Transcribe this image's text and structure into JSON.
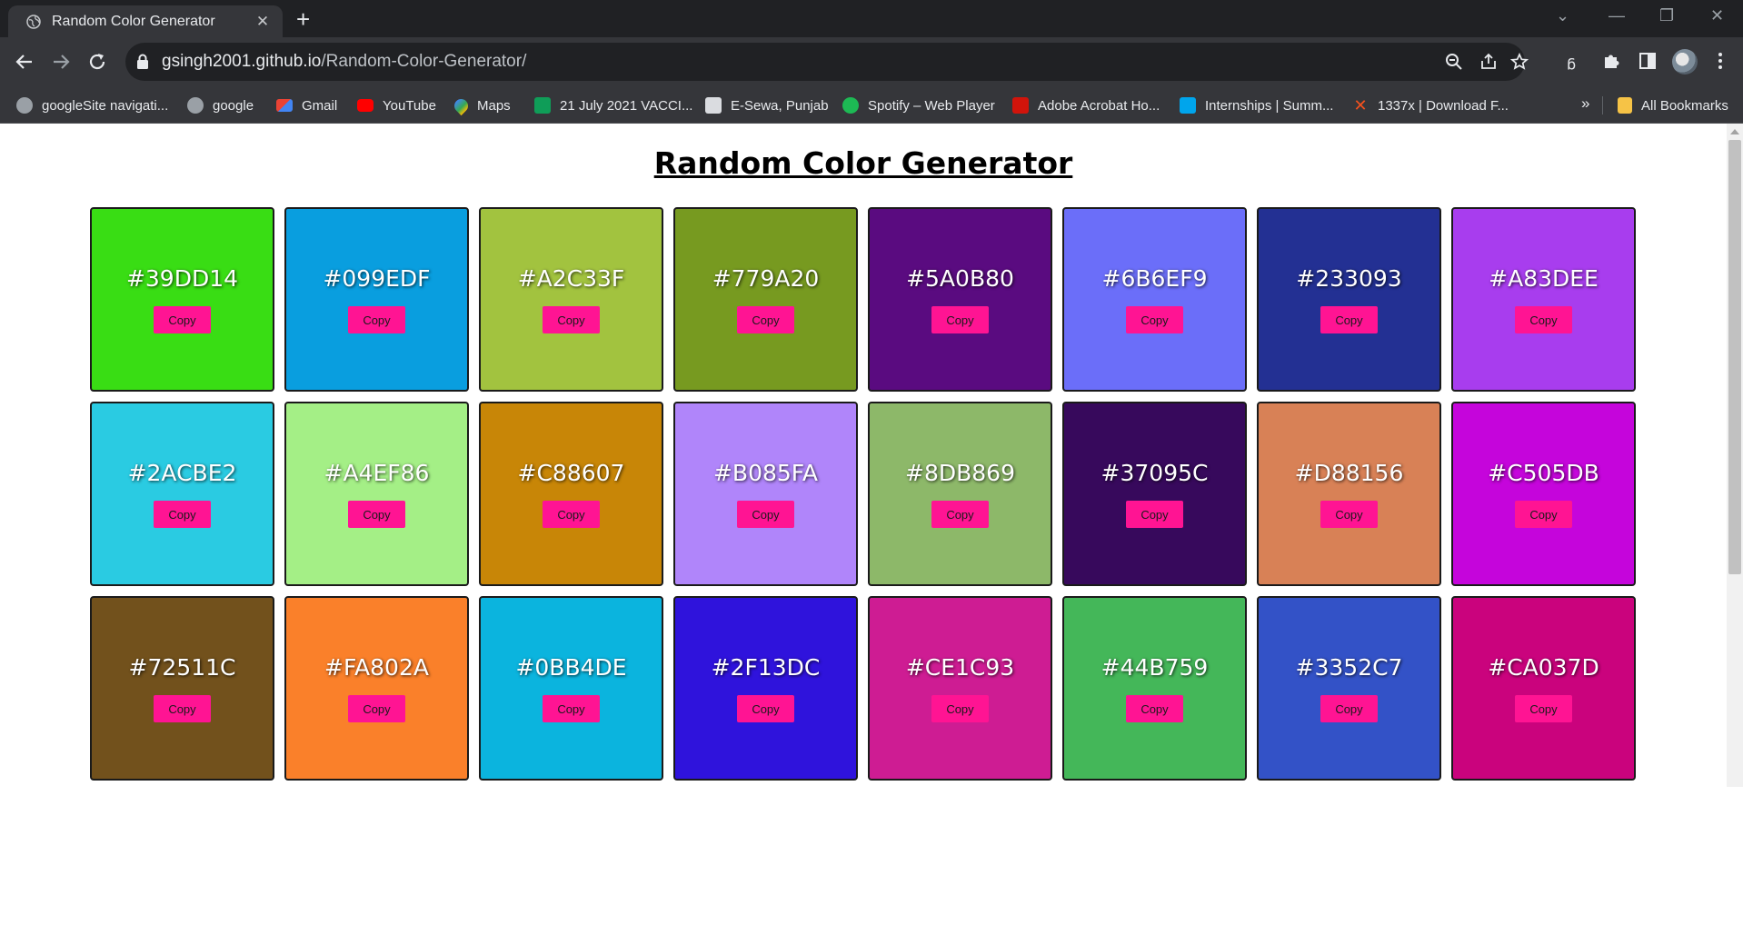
{
  "browser": {
    "tab_title": "Random Color Generator",
    "url_host": "gsingh2001.github.io",
    "url_path": "/Random-Color-Generator/"
  },
  "bookmarks": [
    {
      "label": "googleSite navigati...",
      "icon": "globe-icon",
      "color": "#9aa0a6"
    },
    {
      "label": "google",
      "icon": "globe-icon",
      "color": "#9aa0a6"
    },
    {
      "label": "Gmail",
      "icon": "gmail-icon",
      "color": "#ea4335"
    },
    {
      "label": "YouTube",
      "icon": "youtube-icon",
      "color": "#ff0000"
    },
    {
      "label": "Maps",
      "icon": "maps-icon",
      "color": "#34a853"
    },
    {
      "label": "21 July 2021 VACCI...",
      "icon": "sheets-icon",
      "color": "#0f9d58"
    },
    {
      "label": "E-Sewa, Punjab",
      "icon": "esewa-icon",
      "color": "#dadce0"
    },
    {
      "label": "Spotify – Web Player",
      "icon": "spotify-icon",
      "color": "#1db954"
    },
    {
      "label": "Adobe Acrobat Ho...",
      "icon": "acrobat-icon",
      "color": "#d1140b"
    },
    {
      "label": "Internships | Summ...",
      "icon": "internshala-icon",
      "color": "#00a5ec"
    },
    {
      "label": "1337x | Download F...",
      "icon": "x-icon",
      "color": "#f4511e"
    }
  ],
  "all_bookmarks_label": "All Bookmarks",
  "page": {
    "title": "Random Color Generator",
    "copy_label": "Copy"
  },
  "colors": [
    "#39DD14",
    "#099EDF",
    "#A2C33F",
    "#779A20",
    "#5A0B80",
    "#6B6EF9",
    "#233093",
    "#A83DEE",
    "#2ACBE2",
    "#A4EF86",
    "#C88607",
    "#B085FA",
    "#8DB869",
    "#37095C",
    "#D88156",
    "#C505DB",
    "#72511C",
    "#FA802A",
    "#0BB4DE",
    "#2F13DC",
    "#CE1C93",
    "#44B759",
    "#3352C7",
    "#CA037D"
  ]
}
